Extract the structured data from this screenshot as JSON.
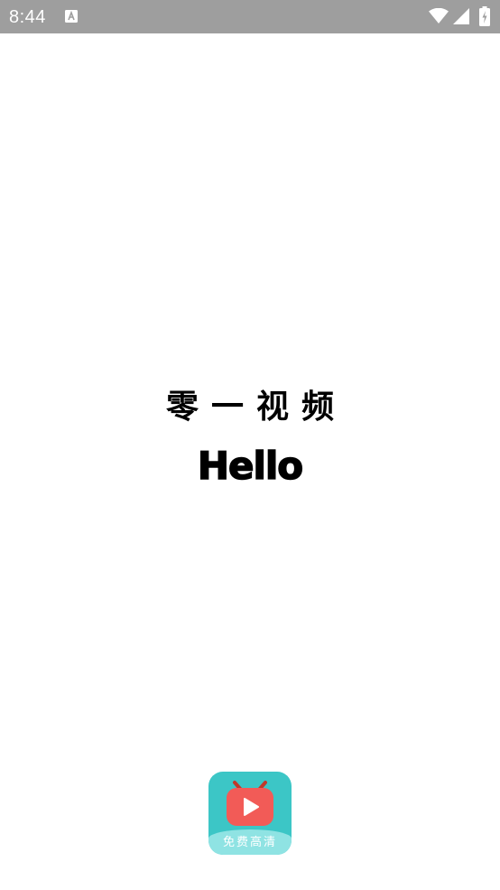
{
  "status_bar": {
    "time": "8:44",
    "icons": [
      "notification-a-icon",
      "wifi-icon",
      "signal-icon",
      "battery-charging-icon"
    ],
    "background_color": "#9e9e9e"
  },
  "splash": {
    "app_name": "零一视频",
    "greeting": "Hello"
  },
  "logo": {
    "caption": "免费高清",
    "colors": {
      "tile": "#3cc6c6",
      "band": "#8fe3e3",
      "tv": "#f25b57",
      "antenna": "#c0392b"
    }
  }
}
